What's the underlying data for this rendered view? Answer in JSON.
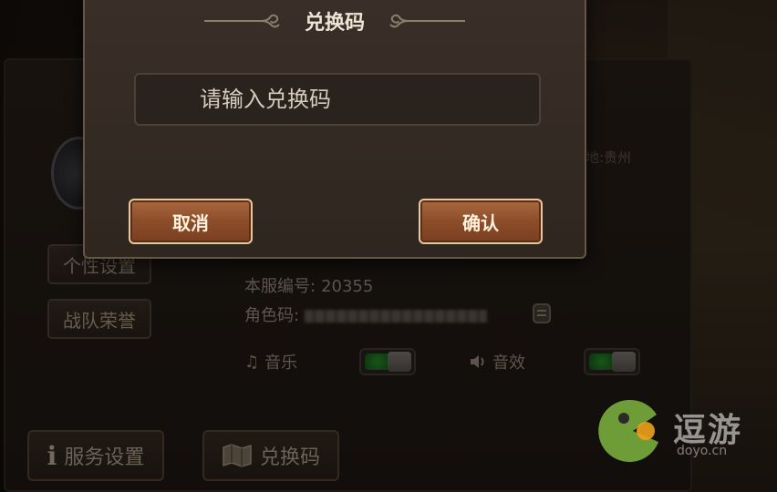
{
  "dialog": {
    "title": "兑换码",
    "input_placeholder": "请输入兑换码",
    "cancel_label": "取消",
    "confirm_label": "确认"
  },
  "panel": {
    "location": "地:贵州",
    "side_buttons": [
      "个性设置",
      "战队荣誉"
    ],
    "server_label": "本服编号:",
    "server_value": "20355",
    "role_code_label": "角色码:",
    "music_label": "音乐",
    "sfx_label": "音效",
    "music_on": true,
    "sfx_on": true,
    "service_settings_label": "服务设置",
    "redeem_label": "兑换码"
  },
  "watermark": {
    "text": "逗游",
    "sub": "doyo.cn"
  },
  "colors": {
    "button_accent": "#8c4d2a",
    "toggle_on": "#2d9c31"
  }
}
